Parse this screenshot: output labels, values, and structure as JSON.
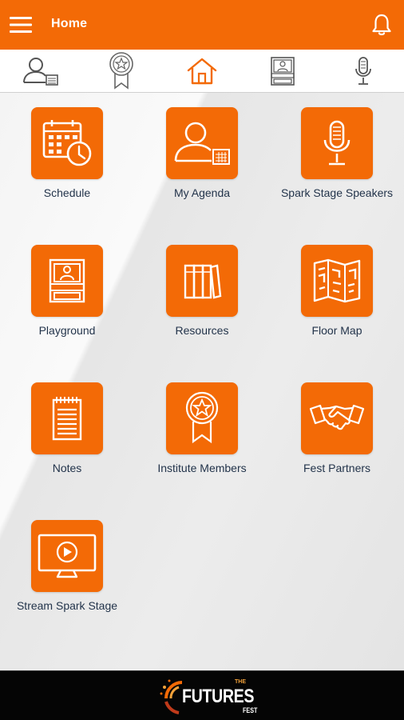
{
  "header": {
    "title": "Home",
    "menu_icon": "hamburger-menu-icon",
    "bell_icon": "bell-icon"
  },
  "tabs": [
    {
      "icon": "user-calendar-icon"
    },
    {
      "icon": "award-ribbon-icon"
    },
    {
      "icon": "home-icon"
    },
    {
      "icon": "booth-icon"
    },
    {
      "icon": "microphone-icon"
    }
  ],
  "tiles": [
    {
      "label": "Schedule",
      "icon": "calendar-clock-icon"
    },
    {
      "label": "My Agenda",
      "icon": "user-calendar-icon"
    },
    {
      "label": "Spark Stage Speakers",
      "icon": "microphone-icon"
    },
    {
      "label": "Playground",
      "icon": "booth-icon"
    },
    {
      "label": "Resources",
      "icon": "books-icon"
    },
    {
      "label": "Floor Map",
      "icon": "map-icon"
    },
    {
      "label": "Notes",
      "icon": "notepad-icon"
    },
    {
      "label": "Institute Members",
      "icon": "award-ribbon-icon"
    },
    {
      "label": "Fest Partners",
      "icon": "handshake-icon"
    },
    {
      "label": "Stream Spark Stage",
      "icon": "video-monitor-icon"
    }
  ],
  "footer": {
    "logo_small_top": "THE",
    "logo_word": "FUTURES",
    "logo_small_bottom": "FEST"
  },
  "colors": {
    "accent": "#f36a06",
    "label_text": "#23344b",
    "footer_bg": "#050505"
  }
}
